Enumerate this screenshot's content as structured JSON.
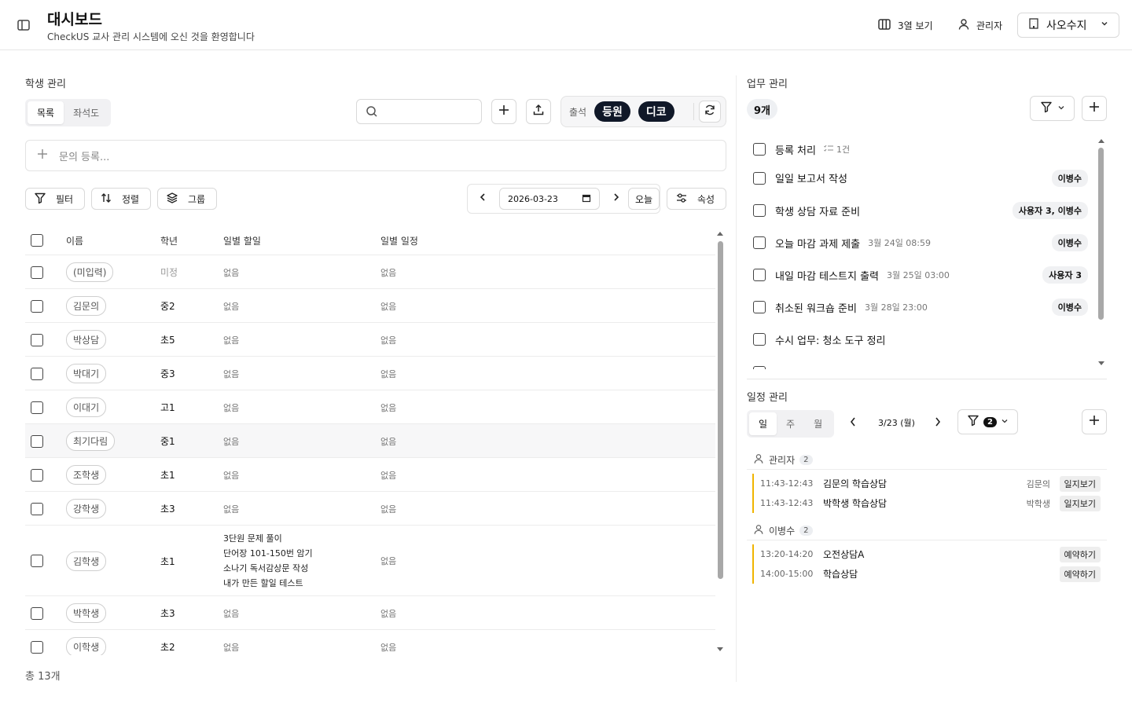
{
  "header": {
    "title": "대시보드",
    "subtitle": "CheckUS 교사 관리 시스템에 오신 것을 환영합니다",
    "view_label": "3열 보기",
    "admin_label": "관리자",
    "user_select": "사오수지"
  },
  "students": {
    "section_label": "학생 관리",
    "view_tabs": [
      "목록",
      "좌석도"
    ],
    "search_placeholder": "",
    "status_label": "출석",
    "status_pills": [
      "등원",
      "디코"
    ],
    "inquiry_placeholder": "문의 등록...",
    "toolbar": {
      "filter": "필터",
      "sort": "정렬",
      "group": "그룹",
      "properties": "속성"
    },
    "date": "2026-03-23",
    "today": "오늘",
    "columns": [
      "이름",
      "학년",
      "일별 할일",
      "일별 일정"
    ],
    "rows": [
      {
        "name": "(미입력)",
        "grade": "미정",
        "todo": [
          "없음"
        ],
        "schedule": "없음"
      },
      {
        "name": "김문의",
        "grade": "중2",
        "todo": [
          "없음"
        ],
        "schedule": "없음"
      },
      {
        "name": "박상담",
        "grade": "초5",
        "todo": [
          "없음"
        ],
        "schedule": "없음"
      },
      {
        "name": "박대기",
        "grade": "중3",
        "todo": [
          "없음"
        ],
        "schedule": "없음"
      },
      {
        "name": "이대기",
        "grade": "고1",
        "todo": [
          "없음"
        ],
        "schedule": "없음"
      },
      {
        "name": "최기다림",
        "grade": "중1",
        "todo": [
          "없음"
        ],
        "schedule": "없음"
      },
      {
        "name": "조학생",
        "grade": "초1",
        "todo": [
          "없음"
        ],
        "schedule": "없음"
      },
      {
        "name": "강학생",
        "grade": "초3",
        "todo": [
          "없음"
        ],
        "schedule": "없음"
      },
      {
        "name": "김학생",
        "grade": "초1",
        "todo": [
          "3단원 문제 풀이",
          "단어장 101-150번 암기",
          "소나기 독서감상문 작성",
          "내가 만든 할일 테스트"
        ],
        "schedule": "없음"
      },
      {
        "name": "박학생",
        "grade": "초3",
        "todo": [
          "없음"
        ],
        "schedule": "없음"
      },
      {
        "name": "이학생",
        "grade": "초2",
        "todo": [
          "없음"
        ],
        "schedule": "없음"
      }
    ],
    "total": "총 13개"
  },
  "tasks": {
    "section_label": "업무 관리",
    "count": "9개",
    "items": [
      {
        "title": "등록 처리",
        "meta": "1건",
        "assignee": ""
      },
      {
        "title": "일일 보고서 작성",
        "meta": "",
        "assignee": "이병수"
      },
      {
        "title": "학생 상담 자료 준비",
        "meta": "",
        "assignee": "사용자 3, 이병수"
      },
      {
        "title": "오늘 마감 과제 제출",
        "meta": "3월 24일 08:59",
        "assignee": "이병수"
      },
      {
        "title": "내일 마감 테스트지 출력",
        "meta": "3월 25일 03:00",
        "assignee": "사용자 3"
      },
      {
        "title": "취소된 워크숍 준비",
        "meta": "3월 28일 23:00",
        "assignee": "이병수"
      },
      {
        "title": "수시 업무: 청소 도구 정리",
        "meta": "",
        "assignee": ""
      }
    ]
  },
  "schedule": {
    "section_label": "일정 관리",
    "view_tabs": [
      "일",
      "주",
      "월"
    ],
    "date_label": "3/23 (월)",
    "filter_count": "2",
    "groups": [
      {
        "owner": "관리자",
        "count": "2",
        "events": [
          {
            "time": "11:43-12:43",
            "title": "김문의 학습상담",
            "student": "김문의",
            "action": "일지보기"
          },
          {
            "time": "11:43-12:43",
            "title": "박학생 학습상담",
            "student": "박학생",
            "action": "일지보기"
          }
        ]
      },
      {
        "owner": "이병수",
        "count": "2",
        "events": [
          {
            "time": "13:20-14:20",
            "title": "오전상담A",
            "student": "",
            "action": "예약하기"
          },
          {
            "time": "14:00-15:00",
            "title": "학습상담",
            "student": "",
            "action": "예약하기"
          }
        ]
      }
    ]
  },
  "colors": {
    "dark_pill": "#101828",
    "event_bar": "#f0b400"
  }
}
